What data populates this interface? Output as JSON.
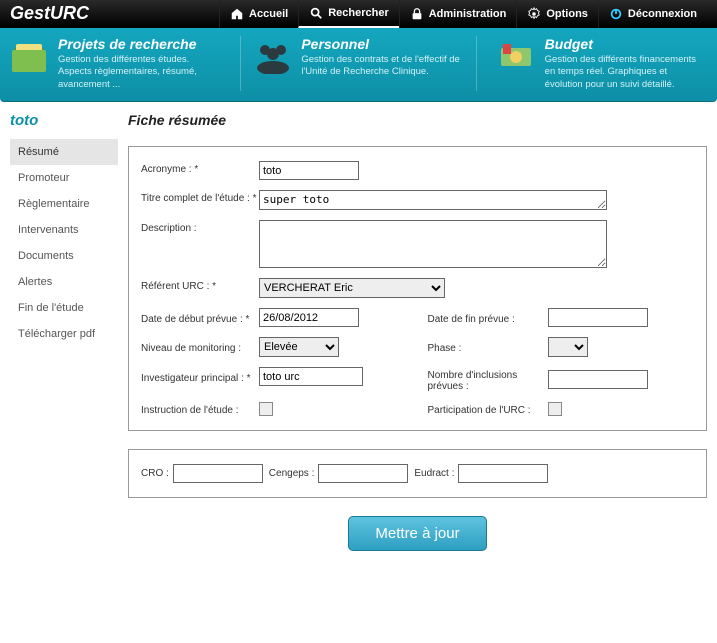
{
  "app": {
    "title": "GestURC"
  },
  "nav": {
    "home": "Accueil",
    "search": "Rechercher",
    "admin": "Administration",
    "options": "Options",
    "logout": "Déconnexion"
  },
  "teal": {
    "projects": {
      "title": "Projets de recherche",
      "desc": "Gestion des différentes études. Aspects règlementaires, résumé, avancement ..."
    },
    "personnel": {
      "title": "Personnel",
      "desc": "Gestion des contrats et de l'effectif de l'Unité de Recherche Clinique."
    },
    "budget": {
      "title": "Budget",
      "desc": "Gestion des différents financements en temps réel. Graphiques et évolution pour un suivi détaillé."
    }
  },
  "sidebar": {
    "title": "toto",
    "items": [
      "Résumé",
      "Promoteur",
      "Règlementaire",
      "Intervenants",
      "Documents",
      "Alertes",
      "Fin de l'étude",
      "Télécharger pdf"
    ],
    "activeIndex": 0
  },
  "page": {
    "heading": "Fiche résumée"
  },
  "form": {
    "acronyme_label": "Acronyme : *",
    "acronyme_value": "toto",
    "titre_label": "Titre complet de l'étude : *",
    "titre_value": "super toto",
    "description_label": "Description :",
    "description_value": "",
    "referent_label": "Référent URC : *",
    "referent_value": "VERCHERAT Eric",
    "date_debut_label": "Date de début prévue : *",
    "date_debut_value": "26/08/2012",
    "date_fin_label": "Date de fin prévue :",
    "date_fin_value": "",
    "niveau_label": "Niveau de monitoring :",
    "niveau_value": "Elevée",
    "phase_label": "Phase :",
    "phase_value": "",
    "investigateur_label": "Investigateur principal : *",
    "investigateur_value": "toto urc",
    "inclusions_label": "Nombre d'inclusions prévues :",
    "inclusions_value": "",
    "instruction_label": "Instruction de l'étude :",
    "participation_label": "Participation de l'URC :"
  },
  "panel2": {
    "cro_label": "CRO :",
    "cro_value": "",
    "cengeps_label": "Cengeps :",
    "cengeps_value": "",
    "eudract_label": "Eudract :",
    "eudract_value": ""
  },
  "actions": {
    "update_label": "Mettre à jour"
  }
}
